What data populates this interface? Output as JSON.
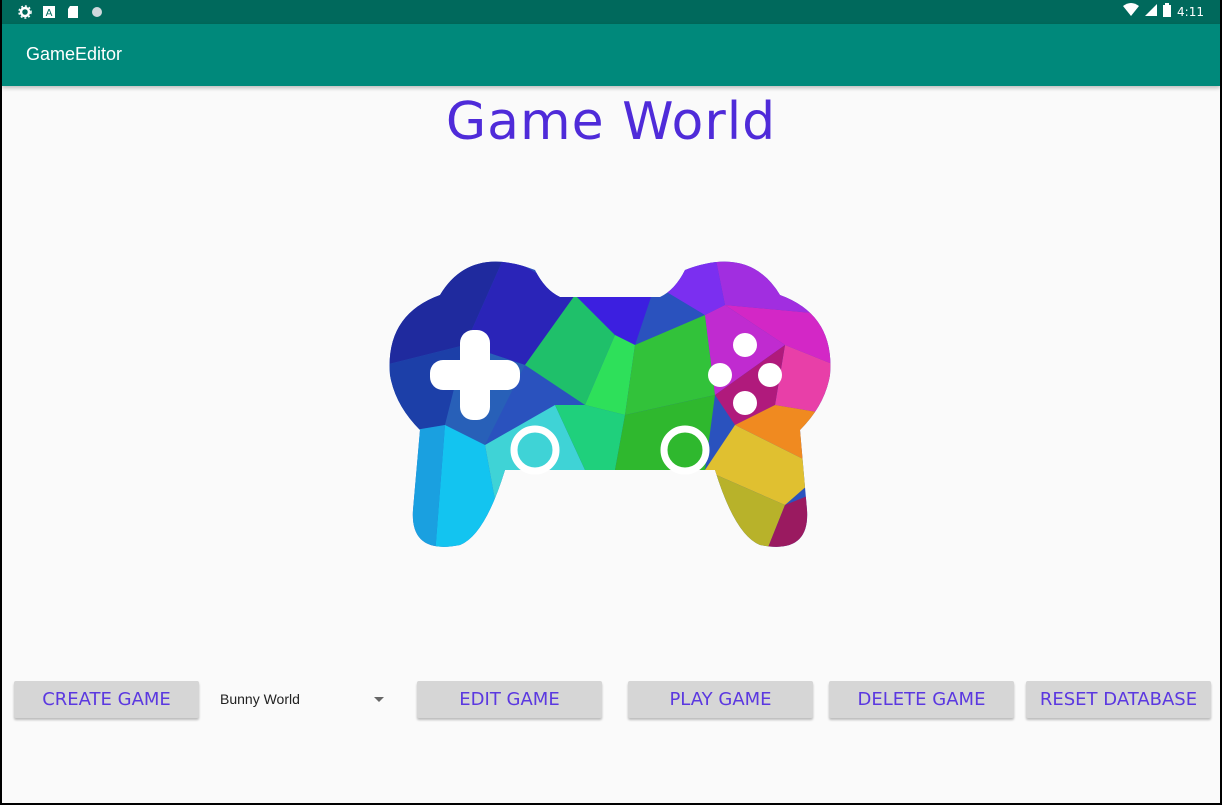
{
  "status_bar": {
    "time": "4:11",
    "icons": [
      "gear-icon",
      "a-icon",
      "sd-card-icon",
      "circle-icon",
      "wifi-icon",
      "signal-icon",
      "battery-icon"
    ]
  },
  "app_bar": {
    "title": "GameEditor"
  },
  "main": {
    "title": "Game World",
    "logo": "gamepad-icon"
  },
  "actions": {
    "create": "CREATE GAME",
    "game_select": {
      "selected": "Bunny World"
    },
    "edit": "EDIT GAME",
    "play": "PLAY GAME",
    "delete": "DELETE GAME",
    "reset": "RESET DATABASE"
  },
  "colors": {
    "status_bar": "#00695c",
    "app_bar": "#00897b",
    "title_text": "#4f2bd9",
    "button_bg": "#d6d6d6",
    "button_text": "#5b38e0"
  }
}
